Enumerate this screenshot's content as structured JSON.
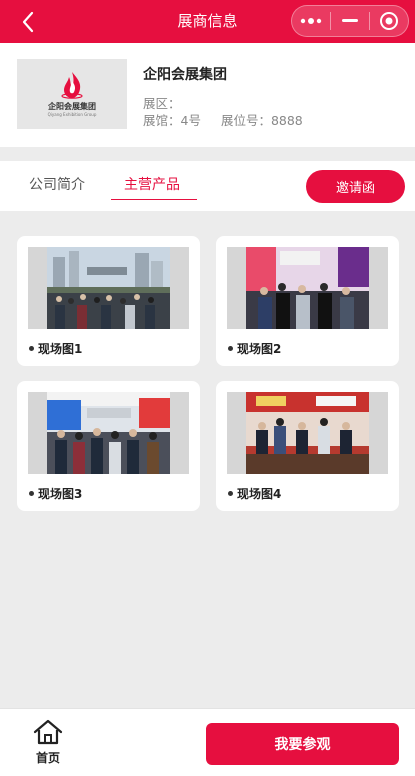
{
  "navbar": {
    "title": "展商信息",
    "back_icon": "chevron-left-icon",
    "capsule_icons": [
      "more-dots-icon",
      "minimize-icon",
      "target-circle-icon"
    ]
  },
  "company": {
    "logo_text": "企阳会展集团",
    "logo_subtext": "Qiyang Exhibition Group",
    "name": "企阳会展集团",
    "area_label": "展区：",
    "hall_label": "展馆：4号",
    "booth_label": "展位号：8888"
  },
  "tabs": {
    "items": [
      {
        "label": "公司简介"
      },
      {
        "label": "主营产品"
      }
    ],
    "active_index": 1,
    "invite_label": "邀请函"
  },
  "gallery": {
    "items": [
      {
        "label": "现场图1"
      },
      {
        "label": "现场图2"
      },
      {
        "label": "现场图3"
      },
      {
        "label": "现场图4"
      }
    ]
  },
  "bottom": {
    "home_label": "首页",
    "visit_label": "我要参观"
  },
  "colors": {
    "accent": "#e60f3f",
    "background": "#ececec"
  }
}
